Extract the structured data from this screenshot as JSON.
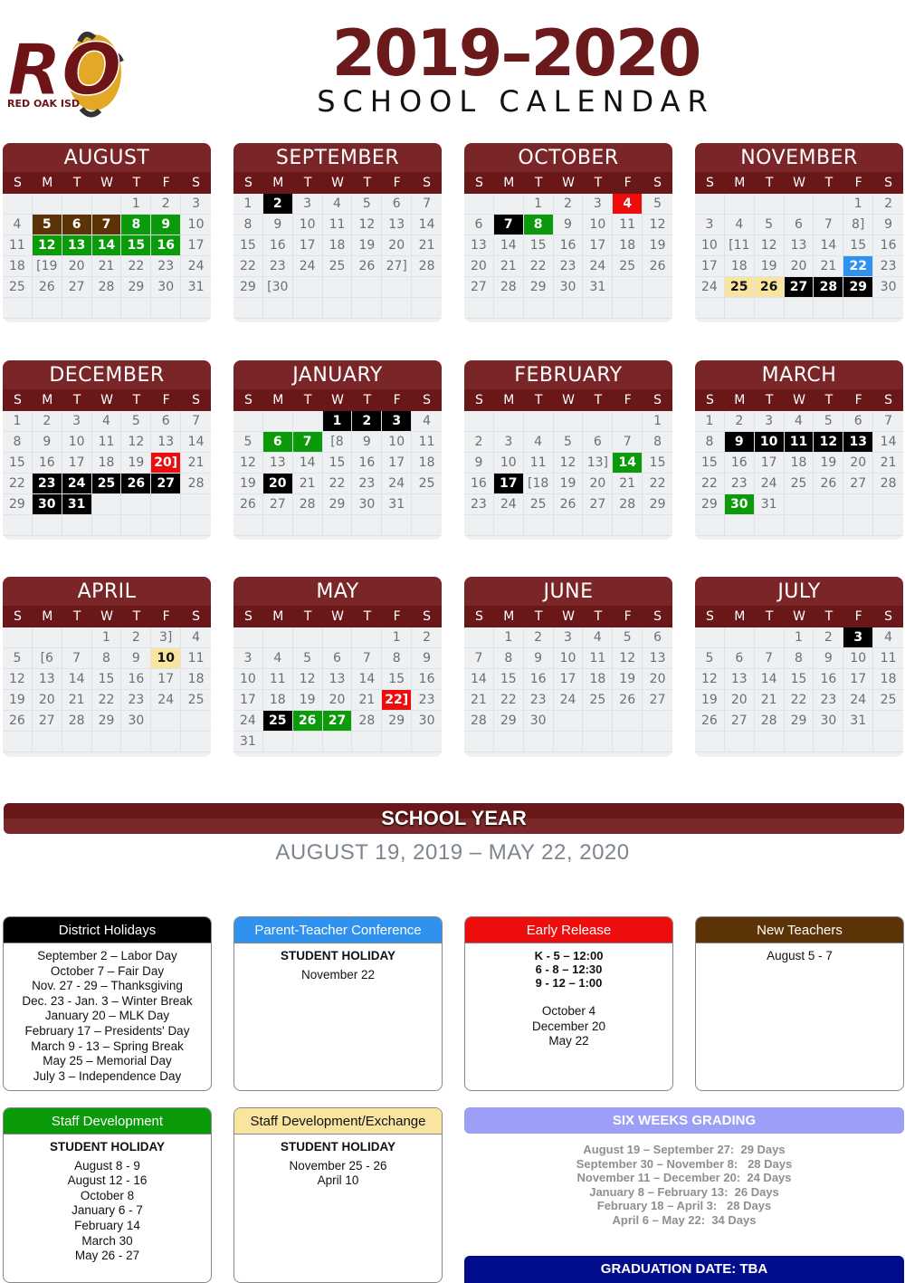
{
  "header": {
    "logo_text": "RED OAK ISD",
    "logo_monogram": "RO",
    "title_year": "2019–2020",
    "title_sub": "SCHOOL CALENDAR"
  },
  "colors": {
    "maroon": "#7a2628",
    "black": "#000000",
    "green": "#0a9a0a",
    "brown": "#5c3306",
    "red": "#ee0d0d",
    "blue": "#2f92ee",
    "yellow": "#fae5a0",
    "lavender": "#9d9ef5",
    "navy": "#020d8c"
  },
  "weekdays": [
    "S",
    "M",
    "T",
    "W",
    "T",
    "F",
    "S"
  ],
  "months": [
    {
      "name": "AUGUST",
      "start": 4,
      "days": 31,
      "highlights": {
        "5": "brown",
        "6": "brown",
        "7": "brown",
        "8": "green",
        "9": "green",
        "12": "green",
        "13": "green",
        "14": "green",
        "15": "green",
        "16": "green"
      },
      "marks": {
        "19": "[19"
      }
    },
    {
      "name": "SEPTEMBER",
      "start": 0,
      "days": 30,
      "highlights": {
        "2": "black"
      },
      "marks": {
        "27": "27]",
        "30": "[30"
      }
    },
    {
      "name": "OCTOBER",
      "start": 2,
      "days": 31,
      "highlights": {
        "4": "red",
        "7": "black",
        "8": "green"
      },
      "marks": {}
    },
    {
      "name": "NOVEMBER",
      "start": 5,
      "days": 30,
      "highlights": {
        "22": "blue",
        "25": "yellow",
        "26": "yellow",
        "27": "black",
        "28": "black",
        "29": "black"
      },
      "marks": {
        "8": "8]",
        "11": "[11"
      }
    },
    {
      "name": "DECEMBER",
      "start": 0,
      "days": 31,
      "highlights": {
        "20": "red",
        "23": "black",
        "24": "black",
        "25": "black",
        "26": "black",
        "27": "black",
        "30": "black",
        "31": "black"
      },
      "marks": {
        "20": "20]"
      }
    },
    {
      "name": "JANUARY",
      "start": 3,
      "days": 31,
      "highlights": {
        "1": "black",
        "2": "black",
        "3": "black",
        "6": "green",
        "7": "green",
        "20": "black"
      },
      "marks": {
        "8": "[8"
      }
    },
    {
      "name": "FEBRUARY",
      "start": 6,
      "days": 29,
      "highlights": {
        "14": "green",
        "17": "black"
      },
      "marks": {
        "13": "13]",
        "18": "[18"
      }
    },
    {
      "name": "MARCH",
      "start": 0,
      "days": 31,
      "highlights": {
        "9": "black",
        "10": "black",
        "11": "black",
        "12": "black",
        "13": "black",
        "30": "green"
      },
      "marks": {}
    },
    {
      "name": "APRIL",
      "start": 3,
      "days": 30,
      "highlights": {
        "10": "yellow"
      },
      "marks": {
        "3": "3]",
        "6": "[6"
      }
    },
    {
      "name": "MAY",
      "start": 5,
      "days": 31,
      "highlights": {
        "22": "red",
        "25": "black",
        "26": "green",
        "27": "green"
      },
      "marks": {
        "22": "22]"
      }
    },
    {
      "name": "JUNE",
      "start": 1,
      "days": 30,
      "highlights": {},
      "marks": {}
    },
    {
      "name": "JULY",
      "start": 3,
      "days": 31,
      "highlights": {
        "3": "black"
      },
      "marks": {}
    }
  ],
  "school_year": {
    "label": "SCHOOL YEAR",
    "dates": "AUGUST 19, 2019 – MAY 22, 2020"
  },
  "legend": {
    "district_holidays": {
      "title": "District Holidays",
      "items": [
        "September 2 – Labor Day",
        "October 7 – Fair Day",
        "Nov. 27 - 29 – Thanksgiving",
        "Dec. 23 - Jan. 3 – Winter Break",
        "January 20 – MLK Day",
        "February 17 – Presidents' Day",
        "March 9 - 13 – Spring Break",
        "May 25 – Memorial Day",
        "July 3 – Independence Day"
      ]
    },
    "parent_teacher": {
      "title": "Parent-Teacher Conference",
      "subtitle": "STUDENT HOLIDAY",
      "items": [
        "November 22"
      ]
    },
    "early_release": {
      "title": "Early Release",
      "times": [
        "K - 5 – 12:00",
        "6 - 8 – 12:30",
        "9 - 12 – 1:00"
      ],
      "items": [
        "October 4",
        "December 20",
        "May 22"
      ]
    },
    "new_teachers": {
      "title": "New Teachers",
      "items": [
        "August 5 - 7"
      ]
    },
    "staff_development": {
      "title": "Staff Development",
      "subtitle": "STUDENT HOLIDAY",
      "items": [
        "August 8 - 9",
        "August 12 - 16",
        "October 8",
        "January 6 - 7",
        "February 14",
        "March 30",
        "May 26 - 27"
      ]
    },
    "staff_exchange": {
      "title": "Staff Development/Exchange",
      "subtitle": "STUDENT HOLIDAY",
      "items": [
        "November 25 - 26",
        "April 10"
      ]
    }
  },
  "grading": {
    "title": "SIX WEEKS GRADING",
    "periods": [
      "August 19 – September 27:  29 Days",
      "September 30 – November 8:   28 Days",
      "November 11 – December 20:  24 Days",
      "January 8 – February 13:  26 Days",
      "February 18 – April 3:   28 Days",
      "April 6 – May 22:  34 Days"
    ]
  },
  "graduation": {
    "label": "GRADUATION DATE: TBA"
  }
}
